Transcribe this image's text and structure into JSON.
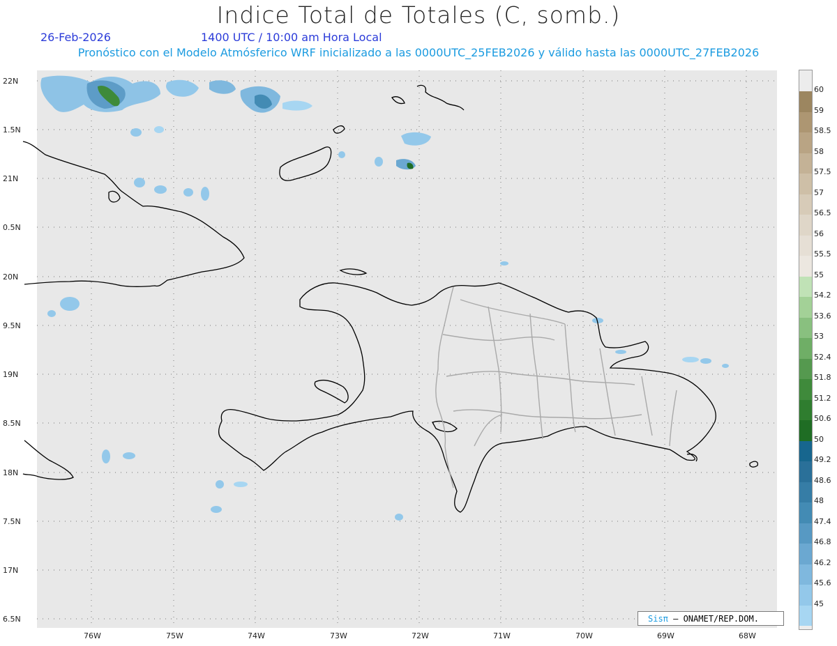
{
  "header": {
    "title": "Indice Total de Totales (C, somb.)",
    "date": "26-Feb-2026",
    "hour": "1400 UTC / 10:00 am Hora Local",
    "forecast": "Pronóstico con el Modelo Atmósferico WRF inicializado a las 0000UTC_25FEB2026 y válido hasta las  0000UTC_27FEB2026"
  },
  "map": {
    "lat_labels": [
      "22N",
      "1.5N",
      "21N",
      "0.5N",
      "20N",
      "9.5N",
      "19N",
      "8.5N",
      "18N",
      "7.5N",
      "17N",
      "6.5N"
    ],
    "lon_labels": [
      "76W",
      "75W",
      "74W",
      "73W",
      "72W",
      "71W",
      "70W",
      "69W",
      "68W"
    ],
    "ocean_color": "#e8e8e8",
    "coast_color": "#000000",
    "province_color": "#a9a9a9"
  },
  "legend": {
    "labels": [
      "60",
      "59",
      "58.5",
      "58",
      "57.5",
      "57",
      "56.5",
      "56",
      "55.5",
      "55",
      "54.2",
      "53.6",
      "53",
      "52.4",
      "51.8",
      "51.2",
      "50.6",
      "50",
      "49.2",
      "48.6",
      "48",
      "47.4",
      "46.8",
      "46.2",
      "45.6",
      "45"
    ],
    "colors": [
      "#9c8660",
      "#ad9672",
      "#b9a484",
      "#c4b296",
      "#cebfa7",
      "#d7cbb8",
      "#dfd6c8",
      "#e6dfd5",
      "#ece7e0",
      "#c0e2b6",
      "#a3d197",
      "#89c07f",
      "#6fae66",
      "#55994f",
      "#3f8a3b",
      "#2f7d2f",
      "#1f6d24",
      "#17668e",
      "#2a7099",
      "#367da6",
      "#438bb4",
      "#5799c3",
      "#6ba8d1",
      "#7fb8de",
      "#93c8ea",
      "#a7d6f2"
    ]
  },
  "credit": {
    "brand": "Sisπ",
    "text": " – ONAMET/REP.DOM."
  }
}
